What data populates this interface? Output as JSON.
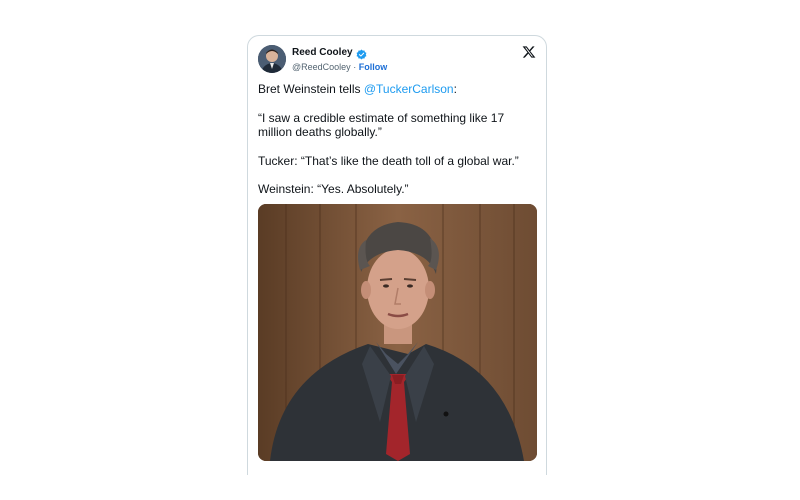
{
  "tweet": {
    "author_name": "Reed Cooley",
    "author_handle": "@ReedCooley",
    "separator": "·",
    "follow_label": "Follow",
    "text_line1_prefix": "Bret Weinstein tells ",
    "mention": "@TuckerCarlson",
    "text_line1_suffix": ":",
    "quote1": "“I saw a credible estimate of something like 17 million deaths globally.”",
    "quote2": "Tucker: “That’s like the death toll of a global war.”",
    "quote3": "Weinstein: “Yes. Absolutely.”"
  },
  "icons": {
    "verified": "verified-badge-icon",
    "platform": "x-logo-icon"
  },
  "colors": {
    "link": "#1d9bf0",
    "verified": "#1d9bf0",
    "follow": "#1d6fd6",
    "border": "#cfd9de"
  }
}
